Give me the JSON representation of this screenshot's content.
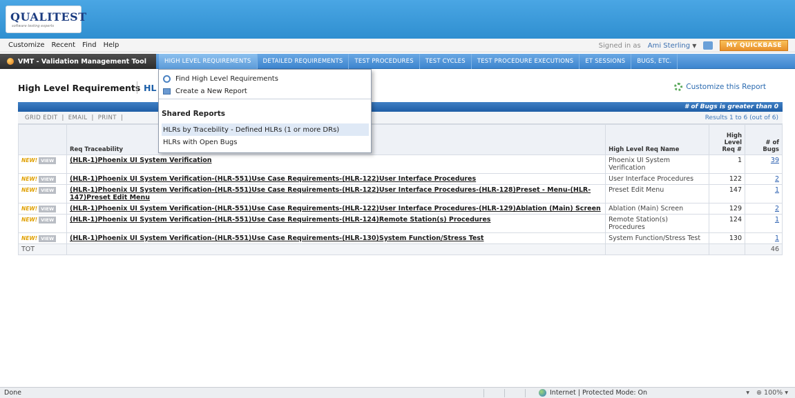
{
  "logo": {
    "text": "QUALITEST",
    "tagline": "software testing experts"
  },
  "menubar": {
    "items": [
      "Customize",
      "Recent",
      "Find",
      "Help"
    ],
    "signed_in_label": "Signed in as",
    "user_name": "Ami Sterling",
    "myqb_label": "MY QUICKBASE"
  },
  "app": {
    "title": "VMT - Validation Management Tool",
    "tabs": [
      "HIGH LEVEL REQUIREMENTS",
      "DETAILED REQUIREMENTS",
      "TEST PROCEDURES",
      "TEST CYCLES",
      "TEST PROCEDURE EXECUTIONS",
      "ET SESSIONS",
      "BUGS, etc."
    ]
  },
  "page": {
    "title": "High Level Requirements",
    "title_2": "HL",
    "customize_label": "Customize this Report"
  },
  "report": {
    "filter_text": "# of Bugs is greater than 0",
    "toolbar_links": [
      "GRID EDIT",
      "|",
      "EMAIL",
      "|",
      "PRINT",
      "|"
    ],
    "results_text": "Results 1 to 6 (out of 6)",
    "columns": {
      "trace": "Req Traceability",
      "name": "High Level Req Name",
      "req": "High Level Req #",
      "bugs": "# of Bugs"
    },
    "row_tags": {
      "new": "NEW!",
      "view": "VIEW"
    },
    "rows": [
      {
        "trace": "(HLR-1)Phoenix UI System Verification",
        "name": "Phoenix UI System Verification",
        "req": "1",
        "bugs": "39"
      },
      {
        "trace": "(HLR-1)Phoenix UI System Verification-(HLR-551)Use Case Requirements-(HLR-122)User Interface Procedures",
        "name": "User Interface Procedures",
        "req": "122",
        "bugs": "2"
      },
      {
        "trace": "(HLR-1)Phoenix UI System Verification-(HLR-551)Use Case Requirements-(HLR-122)User Interface Procedures-(HLR-128)Preset - Menu-(HLR-147)Preset Edit Menu",
        "name": "Preset Edit Menu",
        "req": "147",
        "bugs": "1"
      },
      {
        "trace": "(HLR-1)Phoenix UI System Verification-(HLR-551)Use Case Requirements-(HLR-122)User Interface Procedures-(HLR-129)Ablation (Main) Screen",
        "name": "Ablation (Main) Screen",
        "req": "129",
        "bugs": "2"
      },
      {
        "trace": "(HLR-1)Phoenix UI System Verification-(HLR-551)Use Case Requirements-(HLR-124)Remote Station(s) Procedures",
        "name": "Remote Station(s) Procedures",
        "req": "124",
        "bugs": "1"
      },
      {
        "trace": "(HLR-1)Phoenix UI System Verification-(HLR-551)Use Case Requirements-(HLR-130)System Function/Stress Test",
        "name": "System Function/Stress Test",
        "req": "130",
        "bugs": "1"
      }
    ],
    "total_label": "TOT",
    "total_bugs": "46"
  },
  "dropdown": {
    "find_label": "Find High Level Requirements",
    "create_label": "Create a New Report",
    "shared_header": "Shared Reports",
    "shared_items": [
      "HLRs by Tracebility - Defined HLRs (1 or more DRs)",
      "HLRs with Open Bugs"
    ]
  },
  "statusbar": {
    "done": "Done",
    "zone": "Internet | Protected Mode: On",
    "zoom": "100%"
  }
}
